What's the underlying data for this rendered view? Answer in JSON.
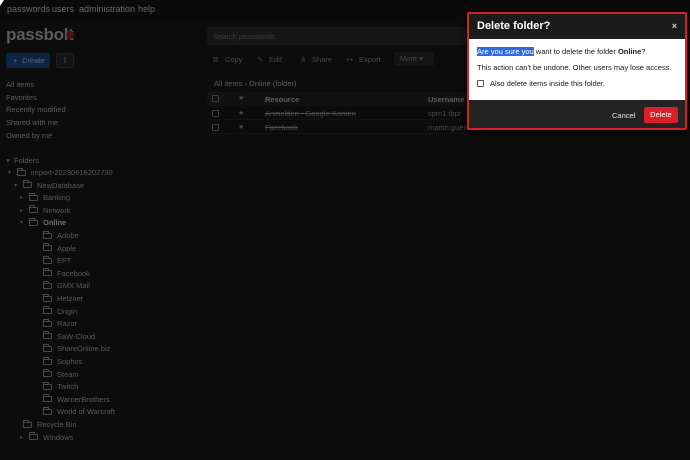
{
  "nav": {
    "items": [
      "passwords",
      "users",
      "administration",
      "help"
    ]
  },
  "brand": {
    "name": "passbolt"
  },
  "search": {
    "placeholder": "Search passwords"
  },
  "sidebar": {
    "create_label": "Create",
    "upload_icon": "upload-icon",
    "filters": [
      "All items",
      "Favorites",
      "Recently modified",
      "Shared with me",
      "Owned by me"
    ],
    "folders_label": "Folders"
  },
  "tree": [
    {
      "label": "import-20230616202730",
      "depth": 1,
      "caret": "▾"
    },
    {
      "label": "NewDatabase",
      "depth": 2,
      "caret": "▾"
    },
    {
      "label": "Banking",
      "depth": 3,
      "caret": "▸"
    },
    {
      "label": "Network",
      "depth": 3,
      "caret": "▸"
    },
    {
      "label": "Online",
      "depth": 3,
      "caret": "▾",
      "bold": true
    },
    {
      "label": "Adobe",
      "depth": 4,
      "caret": ""
    },
    {
      "label": "Apple",
      "depth": 4,
      "caret": ""
    },
    {
      "label": "EFT",
      "depth": 4,
      "caret": ""
    },
    {
      "label": "Facebook",
      "depth": 4,
      "caret": ""
    },
    {
      "label": "GMX Mail",
      "depth": 4,
      "caret": ""
    },
    {
      "label": "Hetzner",
      "depth": 4,
      "caret": ""
    },
    {
      "label": "Origin",
      "depth": 4,
      "caret": ""
    },
    {
      "label": "Razor",
      "depth": 4,
      "caret": ""
    },
    {
      "label": "SaW-Cloud",
      "depth": 4,
      "caret": ""
    },
    {
      "label": "ShareOnline.biz",
      "depth": 4,
      "caret": ""
    },
    {
      "label": "Sophos",
      "depth": 4,
      "caret": ""
    },
    {
      "label": "Steam",
      "depth": 4,
      "caret": ""
    },
    {
      "label": "Twitch",
      "depth": 4,
      "caret": ""
    },
    {
      "label": "WarnerBrothers",
      "depth": 4,
      "caret": ""
    },
    {
      "label": "World of Warcraft",
      "depth": 4,
      "caret": ""
    },
    {
      "label": "Recycle Bin",
      "depth": 2,
      "caret": ""
    },
    {
      "label": "Windows",
      "depth": 3,
      "caret": "▸"
    }
  ],
  "toolbar": {
    "copy": "Copy",
    "edit": "Edit",
    "share": "Share",
    "export": "Export",
    "more": "More"
  },
  "breadcrumb": "All items › Online (folder)",
  "table": {
    "headers": {
      "resource": "Resource",
      "username": "Username"
    },
    "rows": [
      {
        "resource": "Anmelden - Google-Konten",
        "username": "spm1.tbpr"
      },
      {
        "resource": "Facebook",
        "username": "martin.guen"
      }
    ]
  },
  "dialog": {
    "title": "Delete folder?",
    "close": "×",
    "question_highlight": "Are you sure you",
    "question_rest": " want to delete the folder ",
    "folder_name": "Online",
    "question_end": "?",
    "warning": "This action can't be undone. Other users may lose access.",
    "checkbox_label": "Also delete items inside this folder.",
    "cancel_label": "Cancel",
    "delete_label": "Delete",
    "colors": {
      "danger": "#d8202a",
      "highlight": "#3069e0"
    }
  }
}
